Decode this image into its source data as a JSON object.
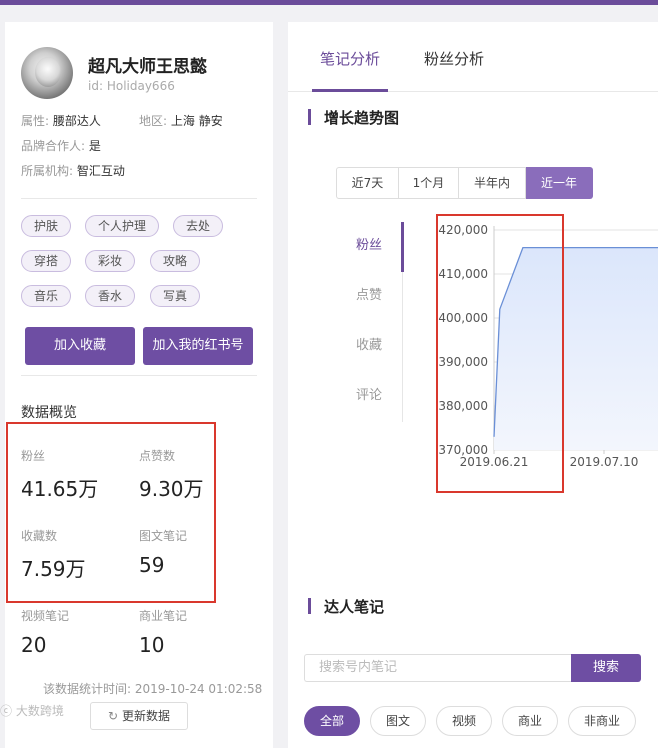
{
  "profile": {
    "name": "超凡大师王思懿",
    "id_label": "id:",
    "id_value": "Holiday666",
    "attr_key": "属性:",
    "attr_val": "腰部达人",
    "region_key": "地区:",
    "region_val": "上海 静安",
    "brand_key": "品牌合作人:",
    "brand_val": "是",
    "org_key": "所属机构:",
    "org_val": "智汇互动"
  },
  "tags": [
    "护肤",
    "个人护理",
    "去处",
    "穿搭",
    "彩妆",
    "攻略",
    "音乐",
    "香水",
    "写真"
  ],
  "actions": {
    "favorite": "加入收藏",
    "add_redbook": "加入我的红书号"
  },
  "overview": {
    "title": "数据概览",
    "stats": [
      {
        "label": "粉丝",
        "value": "41.65万"
      },
      {
        "label": "点赞数",
        "value": "9.30万"
      },
      {
        "label": "收藏数",
        "value": "7.59万"
      },
      {
        "label": "图文笔记",
        "value": "59"
      },
      {
        "label": "视频笔记",
        "value": "20"
      },
      {
        "label": "商业笔记",
        "value": "10"
      }
    ],
    "timestamp": "该数据统计时间: 2019-10-24 01:02:58",
    "refresh_label": "更新数据"
  },
  "watermark": "大数跨境",
  "tabs": [
    "笔记分析",
    "粉丝分析"
  ],
  "trend": {
    "title": "增长趋势图",
    "ranges": [
      "近7天",
      "1个月",
      "半年内",
      "近一年"
    ],
    "active_range": "近一年",
    "metrics": [
      "粉丝",
      "点赞",
      "收藏",
      "评论"
    ],
    "active_metric": "粉丝"
  },
  "notes": {
    "title": "达人笔记",
    "search_placeholder": "搜索号内笔记",
    "search_button": "搜索",
    "filters": [
      "全部",
      "图文",
      "视频",
      "商业",
      "非商业"
    ]
  },
  "colors": {
    "accent": "#6b4c9a",
    "highlight": "#d9382d",
    "line": "#6a8fd6"
  },
  "chart_data": {
    "type": "area",
    "x": [
      "2019.06.21",
      "2019.06.22",
      "2019.06.26",
      "2019.07.10",
      "2019.07.20"
    ],
    "series": [
      {
        "values": [
          373000,
          402000,
          416000,
          416000,
          416000
        ]
      }
    ],
    "y_ticks": [
      "420,000",
      "410,000",
      "400,000",
      "390,000",
      "380,000",
      "370,000"
    ],
    "x_ticks": [
      "2019.06.21",
      "2019.07.10"
    ],
    "ylim": [
      370000,
      420000
    ],
    "grid": true
  }
}
